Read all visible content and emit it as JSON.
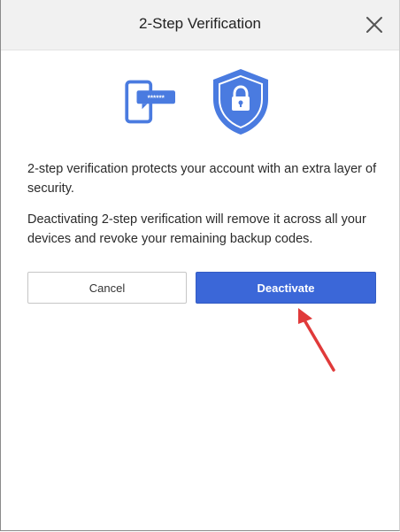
{
  "dialog": {
    "title": "2-Step Verification",
    "close_icon": "close-icon"
  },
  "illustration": {
    "phone_icon": "phone-password-icon",
    "phone_password_mask": "******",
    "shield_icon": "shield-lock-icon"
  },
  "body": {
    "paragraph_1": "2-step verification protects your account with an extra layer of security.",
    "paragraph_2": "Deactivating 2-step verification will remove it across all your devices and revoke your remaining backup codes."
  },
  "actions": {
    "cancel_label": "Cancel",
    "deactivate_label": "Deactivate"
  },
  "annotation": {
    "arrow_icon": "red-arrow-annotation-icon",
    "color": "#e03a3a"
  },
  "colors": {
    "primary": "#3b67d8",
    "icon_blue": "#4a7be0",
    "header_bg": "#f1f1f1"
  }
}
